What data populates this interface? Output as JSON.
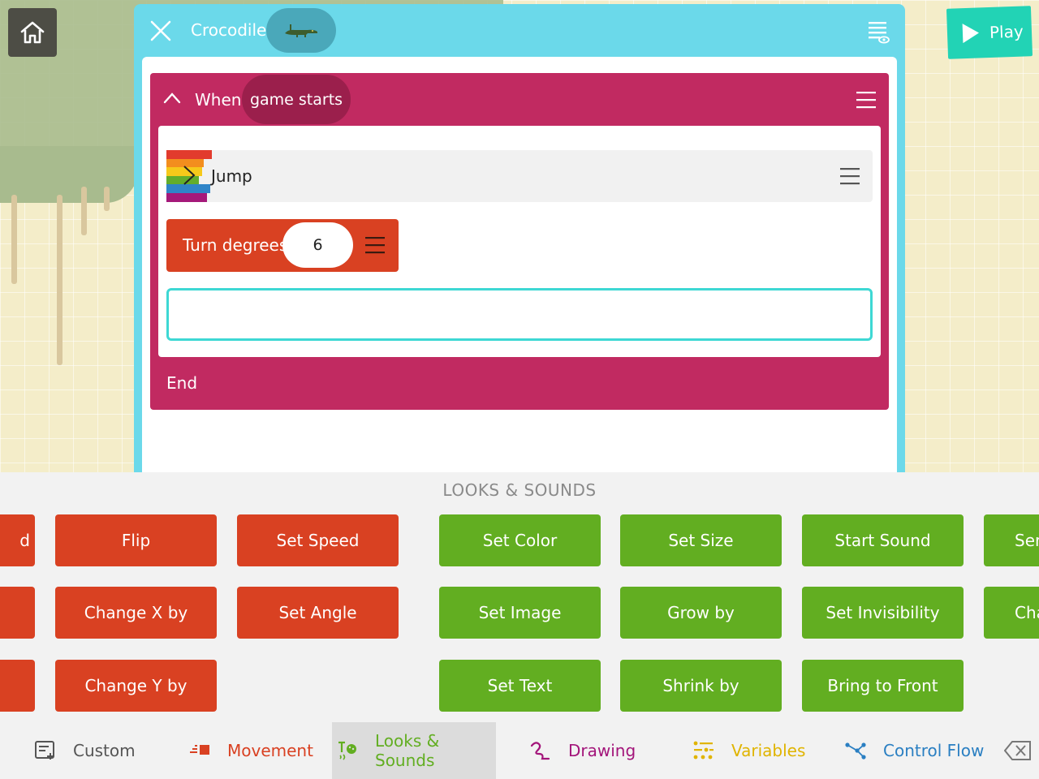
{
  "editor": {
    "object_name": "Crocodile",
    "rule": {
      "when_label": "When",
      "event": "game starts",
      "end_label": "End",
      "blocks": [
        {
          "label": "Jump"
        },
        {
          "label": "Turn degrees",
          "value": "6"
        }
      ]
    }
  },
  "play_label": "Play",
  "palette": {
    "title": "LOOKS & SOUNDS",
    "movement_col0": [
      "d",
      "",
      ""
    ],
    "movement_col1": [
      "Flip",
      "Change X by",
      "Change Y by"
    ],
    "movement_col2": [
      "Set Speed",
      "Set Angle"
    ],
    "looks_col1": [
      "Set Color",
      "Set Image",
      "Set Text"
    ],
    "looks_col2": [
      "Set Size",
      "Grow by",
      "Shrink by"
    ],
    "looks_col3": [
      "Start Sound",
      "Set Invisibility",
      "Bring to Front"
    ],
    "looks_col4": [
      "Ser",
      "Cha"
    ]
  },
  "tabs": [
    {
      "label": "Custom",
      "color": "#555555"
    },
    {
      "label": "Movement",
      "color": "#d94122"
    },
    {
      "label": "Looks & Sounds",
      "color": "#62ae21"
    },
    {
      "label": "Drawing",
      "color": "#a3157a"
    },
    {
      "label": "Variables",
      "color": "#e0b400"
    },
    {
      "label": "Control Flow",
      "color": "#2a7fc2"
    }
  ],
  "colors": {
    "editor_frame": "#6bd9ea",
    "rule_block": "#c12a61",
    "movement": "#d94122",
    "looks": "#62ae21",
    "play": "#22d3b5"
  }
}
